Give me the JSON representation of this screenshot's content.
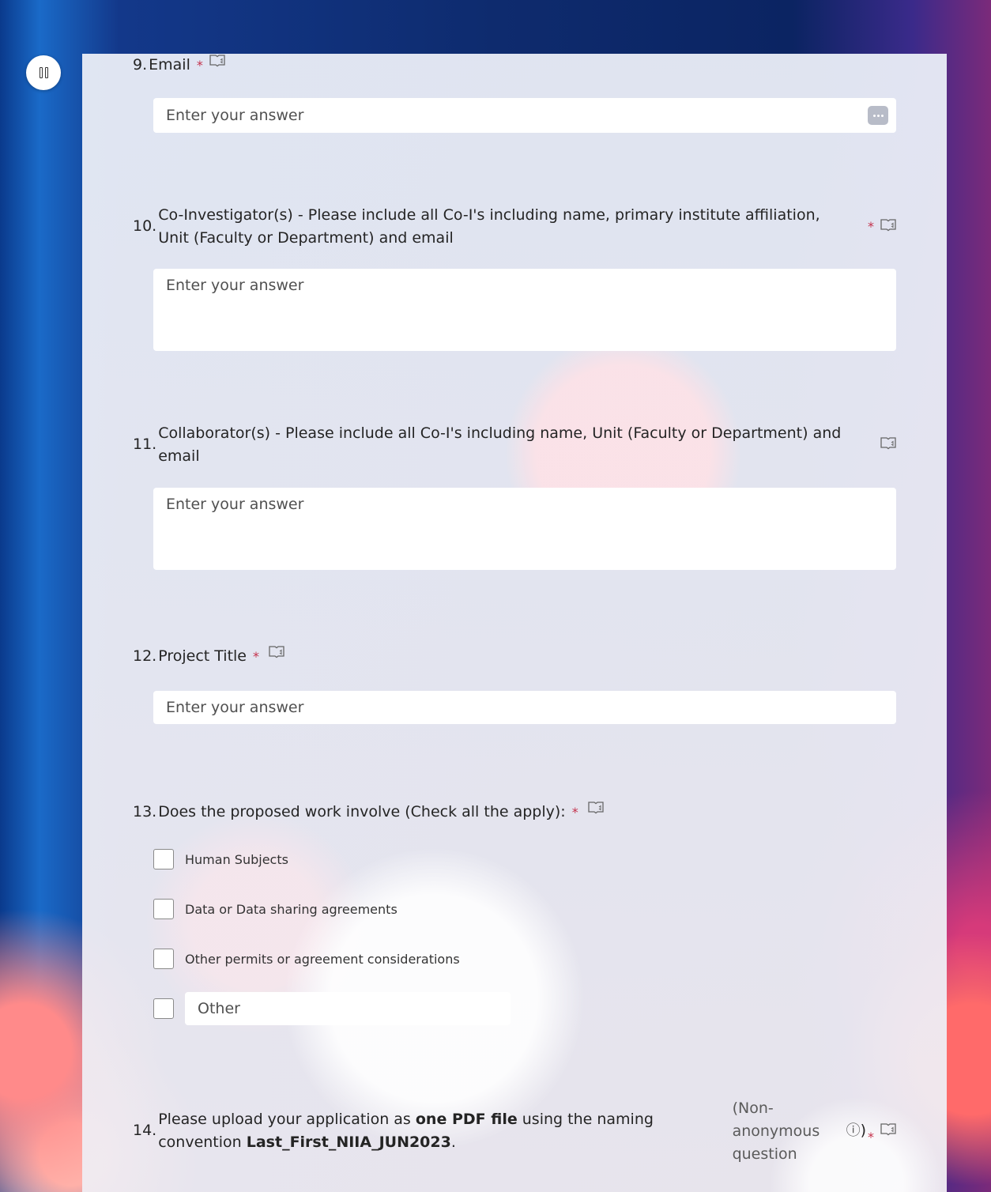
{
  "controls": {
    "pause_label": "pause"
  },
  "questions": {
    "q9": {
      "number": "9.",
      "title": "Email",
      "required_mark": "*",
      "placeholder": "Enter your answer"
    },
    "q10": {
      "number": "10.",
      "title": "Co-Investigator(s) - Please include all Co-I's including name, primary institute affiliation, Unit (Faculty or Department) and email",
      "required_mark": "*",
      "placeholder": "Enter your answer"
    },
    "q11": {
      "number": "11.",
      "title": "Collaborator(s) - Please include all Co-I's including name, Unit (Faculty or Department) and email",
      "placeholder": "Enter your answer"
    },
    "q12": {
      "number": "12.",
      "title": "Project Title",
      "required_mark": "*",
      "placeholder": "Enter your answer"
    },
    "q13": {
      "number": "13.",
      "title": "Does the proposed work involve (Check all the apply):",
      "required_mark": "*",
      "options": [
        "Human Subjects",
        "Data or Data sharing agreements",
        "Other permits or agreement considerations"
      ],
      "other_placeholder": "Other"
    },
    "q14": {
      "number": "14.",
      "title_part1": "Please upload your application as ",
      "title_bold1": "one PDF file",
      "title_part2": " using the naming convention ",
      "title_bold2": "Last_First_NIIA_JUN2023",
      "title_part3": ".",
      "non_anon": "(Non-anonymous question",
      "info_glyph": "ⓘ",
      "close_paren": ")",
      "required_mark": "*"
    }
  },
  "icons": {
    "reader": "immersive-reader-icon",
    "more": "more-options-icon",
    "pause": "pause-icon"
  }
}
